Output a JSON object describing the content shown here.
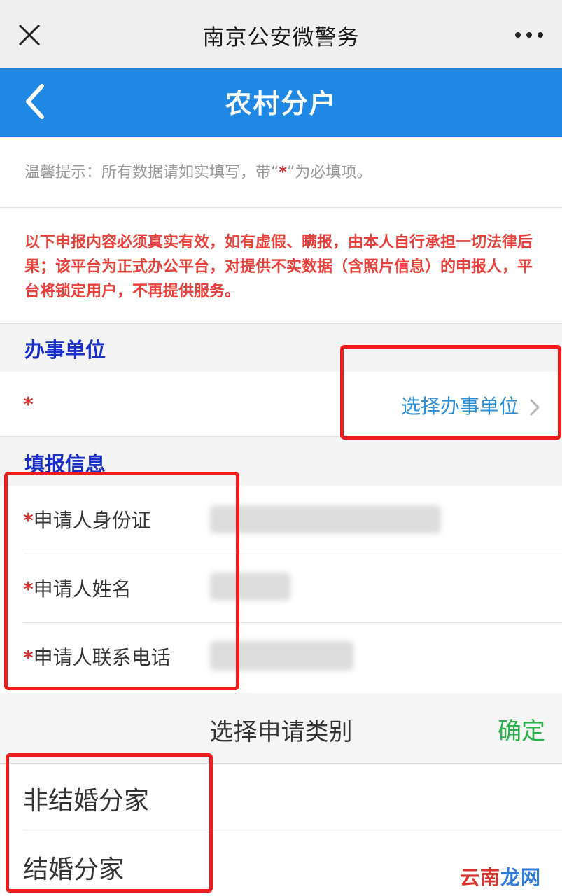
{
  "window": {
    "title": "南京公安微警务",
    "close_icon": "close-icon",
    "more_icon": "more-icon"
  },
  "header": {
    "title": "农村分户",
    "back_icon": "chevron-left-icon"
  },
  "tip": {
    "prefix": "温馨提示：所有数据请如实填写，带“",
    "star": "*",
    "suffix": "”为必填项。"
  },
  "warning": {
    "text": "以下申报内容必须真实有效，如有虚假、瞒报，由本人自行承担一切法律后果；该平台为正式办公平台，对提供不实数据（含照片信息）的申报人，平台将锁定用户，不再提供服务。"
  },
  "unit_section": {
    "title": "办事单位",
    "required_mark": "*",
    "select_label": "选择办事单位"
  },
  "info_section": {
    "title": "填报信息",
    "fields": [
      {
        "required_mark": "*",
        "label": "申请人身份证"
      },
      {
        "required_mark": "*",
        "label": "申请人姓名"
      },
      {
        "required_mark": "*",
        "label": "申请人联系电话"
      }
    ]
  },
  "picker": {
    "title": "选择申请类别",
    "confirm_label": "确定",
    "options": [
      "非结婚分家",
      "结婚分家"
    ]
  },
  "watermark": {
    "part1": "云南",
    "part2": "龙网"
  },
  "colors": {
    "brand_blue": "#1f88e5",
    "warning_red": "#e8403a",
    "section_title": "#1a2fc8",
    "confirm_green": "#2bb14a",
    "highlight_red": "#f01d1d"
  }
}
